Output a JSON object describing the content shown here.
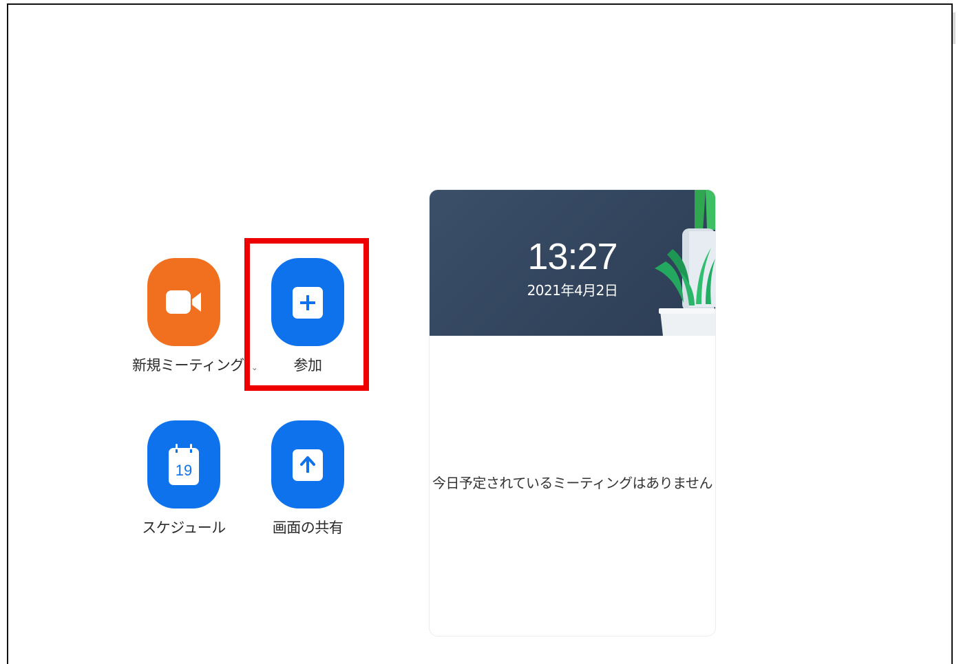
{
  "actions": {
    "new_meeting": {
      "label": "新規ミーティング",
      "caret": "⌄",
      "icon": "video-camera-icon",
      "color": "#f0701f"
    },
    "join": {
      "label": "参加",
      "icon": "plus-icon",
      "color": "#0e72ed",
      "highlighted": true
    },
    "schedule": {
      "label": "スケジュール",
      "icon": "calendar-icon",
      "calendar_day": "19",
      "color": "#0e72ed"
    },
    "share_screen": {
      "label": "画面の共有",
      "icon": "share-up-arrow-icon",
      "color": "#0e72ed"
    }
  },
  "clock_card": {
    "time": "13:27",
    "date": "2021年4月2日",
    "empty_message": "今日予定されているミーティングはありません",
    "header_color": "#34475f",
    "decoration": "plant-icon"
  },
  "highlight": {
    "color": "#ee0000",
    "target": "join"
  }
}
